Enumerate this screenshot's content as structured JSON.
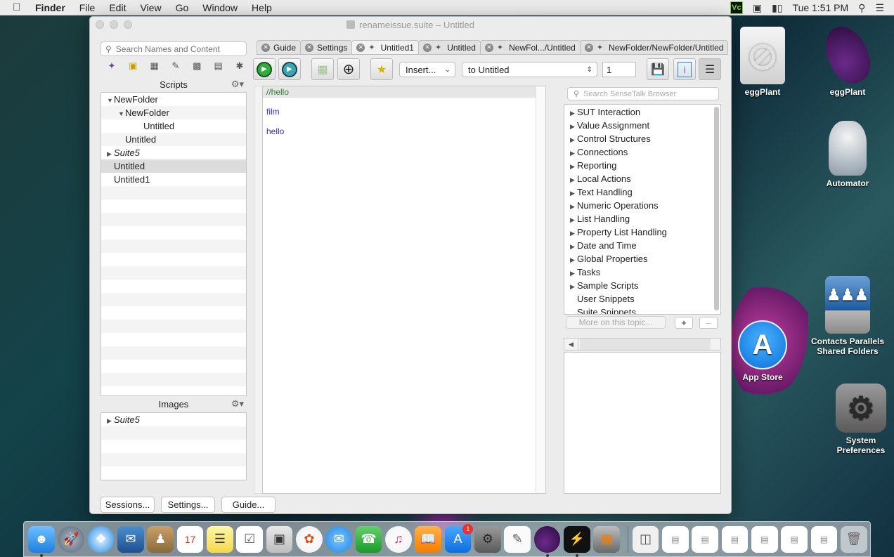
{
  "menubar": {
    "app": "Finder",
    "items": [
      "File",
      "Edit",
      "View",
      "Go",
      "Window",
      "Help"
    ],
    "vc_label": "Vc",
    "clock": "Tue 1:51 PM"
  },
  "window": {
    "title": "renameissue.suite – Untitled",
    "search_placeholder": "Search Names and Content",
    "scripts_header": "Scripts",
    "scripts_tree": [
      {
        "label": "NewFolder",
        "indent": 0,
        "expanded": true,
        "italic": false
      },
      {
        "label": "NewFolder",
        "indent": 1,
        "expanded": true,
        "italic": false
      },
      {
        "label": "Untitled",
        "indent": 2,
        "italic": false
      },
      {
        "label": "Untitled",
        "indent": 1,
        "italic": false
      },
      {
        "label": "Suite5",
        "indent": 0,
        "collapsed": true,
        "italic": true
      },
      {
        "label": "Untitled",
        "indent": 0,
        "italic": false,
        "selected": true
      },
      {
        "label": "Untitled1",
        "indent": 0,
        "italic": false
      }
    ],
    "images_header": "Images",
    "images_tree": [
      {
        "label": "Suite5",
        "italic": true
      }
    ],
    "bottom_buttons": {
      "sessions": "Sessions...",
      "settings": "Settings...",
      "guide": "Guide..."
    },
    "tabs": [
      "Guide",
      "Settings",
      "Untitled1",
      "Untitled",
      "NewFol.../Untitled",
      "NewFolder/NewFolder/Untitled"
    ],
    "toolbar": {
      "insert_label": "Insert...",
      "target_label": "to Untitled",
      "count_value": "1"
    },
    "editor_lines": [
      "//hello",
      "film",
      "hello"
    ],
    "browser_search_placeholder": "Search SenseTalk Browser",
    "browser_items": [
      {
        "label": "SUT Interaction",
        "expandable": true
      },
      {
        "label": "Value Assignment",
        "expandable": true
      },
      {
        "label": "Control Structures",
        "expandable": true
      },
      {
        "label": "Connections",
        "expandable": true
      },
      {
        "label": "Reporting",
        "expandable": true
      },
      {
        "label": "Local Actions",
        "expandable": true
      },
      {
        "label": "Text Handling",
        "expandable": true
      },
      {
        "label": "Numeric Operations",
        "expandable": true
      },
      {
        "label": "List Handling",
        "expandable": true
      },
      {
        "label": "Property List Handling",
        "expandable": true
      },
      {
        "label": "Date and Time",
        "expandable": true
      },
      {
        "label": "Global Properties",
        "expandable": true
      },
      {
        "label": "Tasks",
        "expandable": true
      },
      {
        "label": "Sample Scripts",
        "expandable": true
      },
      {
        "label": "User Snippets",
        "expandable": false
      },
      {
        "label": "Suite Snippets",
        "expandable": false
      }
    ],
    "more_label": "More on this topic...",
    "plus": "+",
    "minus": "–"
  },
  "desktop": {
    "icons": [
      "eggPlant",
      "eggPlant",
      "Automator",
      "Contacts Parallels Shared Folders",
      "App Store",
      "System Preferences"
    ]
  },
  "dock": {
    "messages_badge": "1"
  },
  "colors": {
    "comment": "#2e7d32",
    "code": "#3a2bb3",
    "accent": "#1e88e5"
  }
}
